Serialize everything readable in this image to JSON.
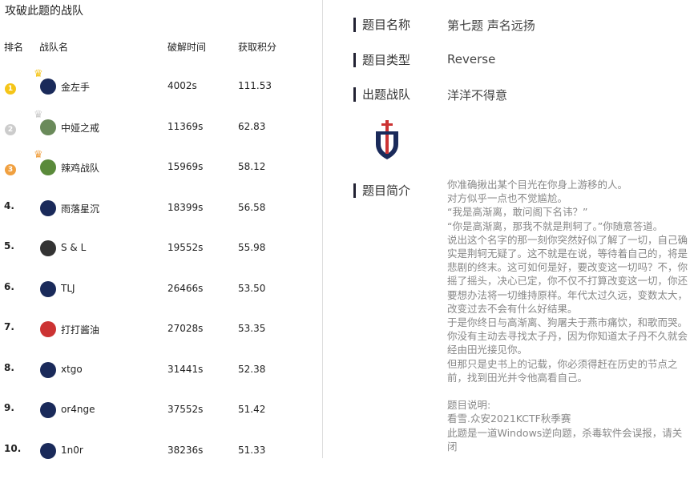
{
  "left": {
    "title": "攻破此题的战队",
    "headers": [
      "排名",
      "战队名",
      "破解时间",
      "获取积分"
    ],
    "rows": [
      {
        "rank": "1",
        "name": "金左手",
        "time": "4002s",
        "score": "111.53",
        "medal": "#f5c518",
        "crown": "#f5c518",
        "avatar": "#1a2a5a"
      },
      {
        "rank": "2",
        "name": "中娅之戒",
        "time": "11369s",
        "score": "62.83",
        "medal": "#ccc",
        "crown": "#ccc",
        "avatar": "#6a8a5a"
      },
      {
        "rank": "3",
        "name": "辣鸡战队",
        "time": "15969s",
        "score": "58.12",
        "medal": "#f0a040",
        "crown": "#f0a040",
        "avatar": "#5a8a3a"
      },
      {
        "rank": "4.",
        "name": "雨落星沉",
        "time": "18399s",
        "score": "56.58",
        "avatar": "#1a2a5a"
      },
      {
        "rank": "5.",
        "name": "S & L",
        "time": "19552s",
        "score": "55.98",
        "avatar": "#333"
      },
      {
        "rank": "6.",
        "name": "TLJ",
        "time": "26466s",
        "score": "53.50",
        "avatar": "#1a2a5a"
      },
      {
        "rank": "7.",
        "name": "打打酱油",
        "time": "27028s",
        "score": "53.35",
        "avatar": "#c33"
      },
      {
        "rank": "8.",
        "name": "xtgo",
        "time": "31441s",
        "score": "52.38",
        "avatar": "#1a2a5a"
      },
      {
        "rank": "9.",
        "name": "or4nge",
        "time": "37552s",
        "score": "51.42",
        "avatar": "#1a2a5a"
      },
      {
        "rank": "10.",
        "name": "1n0r",
        "time": "38236s",
        "score": "51.33",
        "avatar": "#1a2a5a"
      }
    ]
  },
  "right": {
    "name_label": "题目名称",
    "name": "第七题 声名远扬",
    "type_label": "题目类型",
    "type": "Reverse",
    "team_label": "出题战队",
    "team": "洋洋不得意",
    "intro_label": "题目简介",
    "intro": "你准确揪出某个目光在你身上游移的人。\n对方似乎一点也不觉尴尬。\n“我是高渐离，敢问阁下名讳？”\n“你是高渐离，那我不就是荆轲了。”你随意答道。\n说出这个名字的那一刻你突然好似了解了一切，自己确实是荆轲无疑了。这不就是在说，等待着自己的，将是悲剧的终末。这可如何是好，要改变这一切吗？不，你摇了摇头，决心已定，你不仅不打算改变这一切，你还要想办法将一切维持原样。年代太过久远，变数太大，改变过去不会有什么好结果。\n于是你终日与高渐离、狗屠夫于燕市痛饮，和歌而哭。你没有主动去寻找太子丹，因为你知道太子丹不久就会经由田光接见你。\n但那只是史书上的记载，你必须得赶在历史的节点之前，找到田光并令他高看自己。\n\n题目说明:\n看雪.众安2021KCTF秋季赛\n此题是一道Windows逆向题，杀毒软件会误报，请关闭"
  }
}
